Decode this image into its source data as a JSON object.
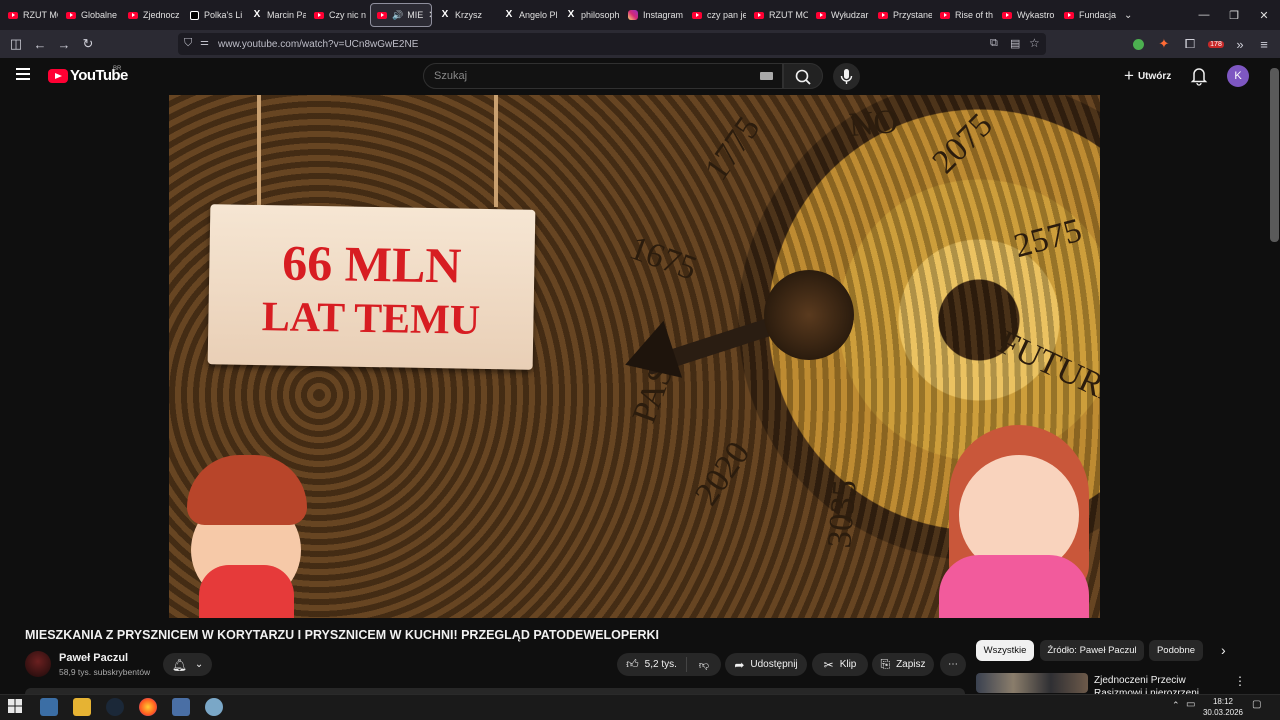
{
  "browser": {
    "tabs": [
      {
        "label": "RZUT MO",
        "icon": "youtube-icon"
      },
      {
        "label": "Globalne",
        "icon": "youtube-icon"
      },
      {
        "label": "Zjednocz",
        "icon": "youtube-icon"
      },
      {
        "label": "Polka's Li",
        "icon": "tiktok-icon"
      },
      {
        "label": "Marcin Pa",
        "icon": "x-icon"
      },
      {
        "label": "Czy nic n",
        "icon": "youtube-icon"
      },
      {
        "label": "MIE",
        "icon": "youtube-icon",
        "active": true
      },
      {
        "label": "Krzysz",
        "icon": "x-icon"
      },
      {
        "label": "Angelo Pl",
        "icon": "x-icon"
      },
      {
        "label": "philosoph",
        "icon": "x-icon"
      },
      {
        "label": "Instagram",
        "icon": "instagram-icon"
      },
      {
        "label": "czy pan je",
        "icon": "youtube-icon"
      },
      {
        "label": "RZUT MO",
        "icon": "youtube-icon"
      },
      {
        "label": "Wyłudzar",
        "icon": "youtube-icon"
      },
      {
        "label": "Przystane",
        "icon": "youtube-icon"
      },
      {
        "label": "Rise of th",
        "icon": "youtube-icon"
      },
      {
        "label": "Wykastro",
        "icon": "youtube-icon"
      },
      {
        "label": "Fundacja",
        "icon": "youtube-icon"
      }
    ],
    "url": "www.youtube.com/watch?v=UCn8wGwE2NE",
    "extension_badge": "178"
  },
  "youtube": {
    "brand": "YouTube",
    "country": "BR",
    "search_placeholder": "Szukaj",
    "create_label": "Utwórz",
    "avatar_letter": "K"
  },
  "video": {
    "sign_line1": "66 MLN",
    "sign_line2": "LAT TEMU",
    "dial_numbers": [
      "1775",
      "NO",
      "2075",
      "1675",
      "2575",
      "PAS",
      "FUTURE",
      "2020",
      "3035"
    ],
    "title": "MIESZKANIA Z PRYSZNICEM W KORYTARZU I PRYSZNICEM W KUCHNI! PRZEGLĄD PATODEWELOPERKI",
    "channel_name": "Paweł Paczul",
    "subscribers": "58,9 tys. subskrybentów",
    "likes": "5,2 tys.",
    "share_label": "Udostępnij",
    "clip_label": "Klip",
    "save_label": "Zapisz"
  },
  "sidebar": {
    "chips": [
      "Wszystkie",
      "Źródło: Paweł Paczul",
      "Podobne"
    ],
    "recommended_title": "Zjednoczeni Przeciw Rasizmowi i nierozrzeni"
  },
  "taskbar": {
    "time": "18:12",
    "date": "30.03.2026"
  }
}
